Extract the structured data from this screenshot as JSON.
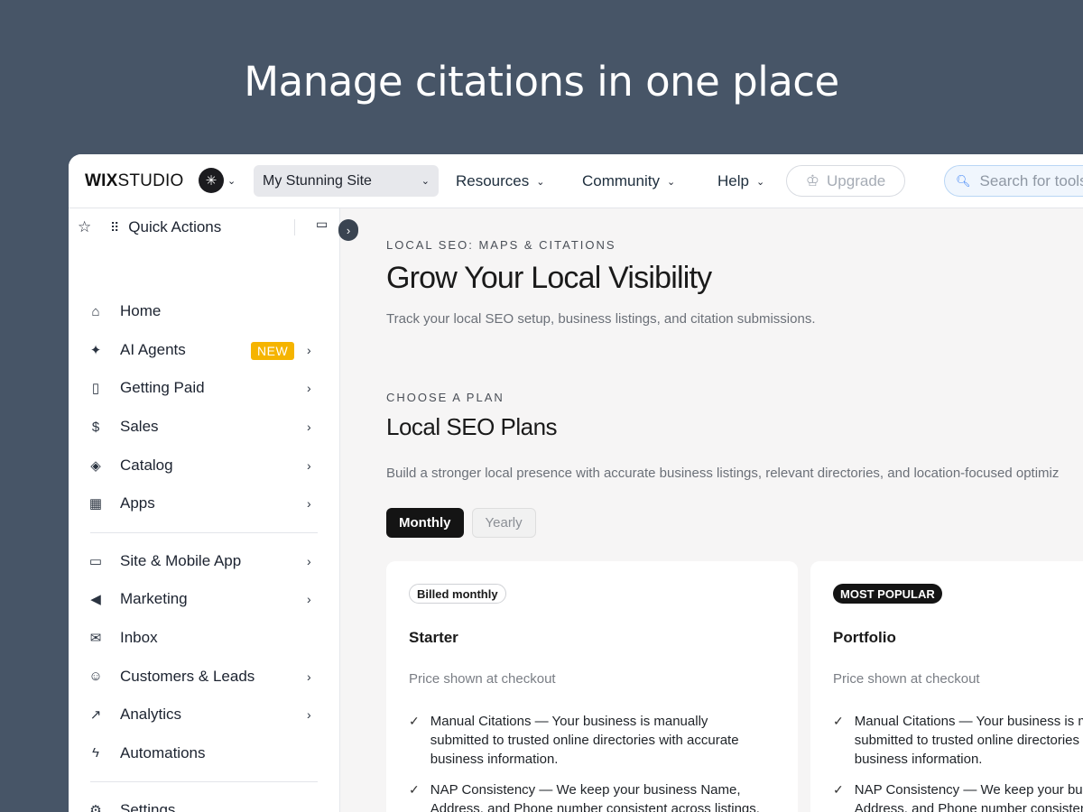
{
  "hero": {
    "title": "Manage citations in one place"
  },
  "topbar": {
    "logo_bold": "WIX",
    "logo_rest": "STUDIO",
    "site_name": "My Stunning Site",
    "nav": [
      "Resources",
      "Community",
      "Help"
    ],
    "upgrade_label": "Upgrade",
    "search_placeholder": "Search for tools"
  },
  "sidebar": {
    "quick_actions_label": "Quick Actions",
    "items_top": [
      {
        "label": "Home",
        "icon": "home-icon",
        "glyph": "⌂",
        "arrow": false
      },
      {
        "label": "AI Agents",
        "icon": "sparkle-icon",
        "glyph": "✦",
        "arrow": true,
        "badge": "NEW"
      },
      {
        "label": "Getting Paid",
        "icon": "invoice-icon",
        "glyph": "🗋",
        "arrow": true
      },
      {
        "label": "Sales",
        "icon": "dollar-icon",
        "glyph": "$",
        "arrow": true
      },
      {
        "label": "Catalog",
        "icon": "catalog-icon",
        "glyph": "◈",
        "arrow": true
      },
      {
        "label": "Apps",
        "icon": "apps-icon",
        "glyph": "▦",
        "arrow": true
      }
    ],
    "items_bottom": [
      {
        "label": "Site & Mobile App",
        "icon": "devices-icon",
        "glyph": "▭",
        "arrow": true
      },
      {
        "label": "Marketing",
        "icon": "megaphone-icon",
        "glyph": "📢",
        "arrow": true
      },
      {
        "label": "Inbox",
        "icon": "inbox-icon",
        "glyph": "✉",
        "arrow": false
      },
      {
        "label": "Customers & Leads",
        "icon": "people-icon",
        "glyph": "👥",
        "arrow": true
      },
      {
        "label": "Analytics",
        "icon": "analytics-icon",
        "glyph": "↗",
        "arrow": true
      },
      {
        "label": "Automations",
        "icon": "bolt-icon",
        "glyph": "⚡",
        "arrow": false
      }
    ],
    "settings_label": "Settings"
  },
  "main": {
    "eyebrow": "LOCAL SEO: MAPS & CITATIONS",
    "title": "Grow Your Local Visibility",
    "subtitle": "Track your local SEO setup, business listings, and citation submissions.",
    "plans_eyebrow": "CHOOSE A PLAN",
    "plans_title": "Local SEO Plans",
    "plans_subtitle": "Build a stronger local presence with accurate business listings, relevant directories, and location-focused optimiz",
    "toggle": {
      "monthly": "Monthly",
      "yearly": "Yearly"
    },
    "cards": [
      {
        "pill": "Billed monthly",
        "name": "Starter",
        "price": "Price shown at checkout",
        "features": [
          "Manual Citations — Your business is manually submitted to trusted online directories with accurate business information.",
          "NAP Consistency — We keep your business Name, Address, and Phone number consistent across listings."
        ]
      },
      {
        "pill": "MOST POPULAR",
        "name": "Portfolio",
        "price": "Price shown at checkout",
        "features": [
          "Manual Citations — Your business is manually submitted to trusted online directories with accurate business information.",
          "NAP Consistency — We keep your business Name, Address, and Phone number consistent across listings."
        ]
      }
    ]
  }
}
